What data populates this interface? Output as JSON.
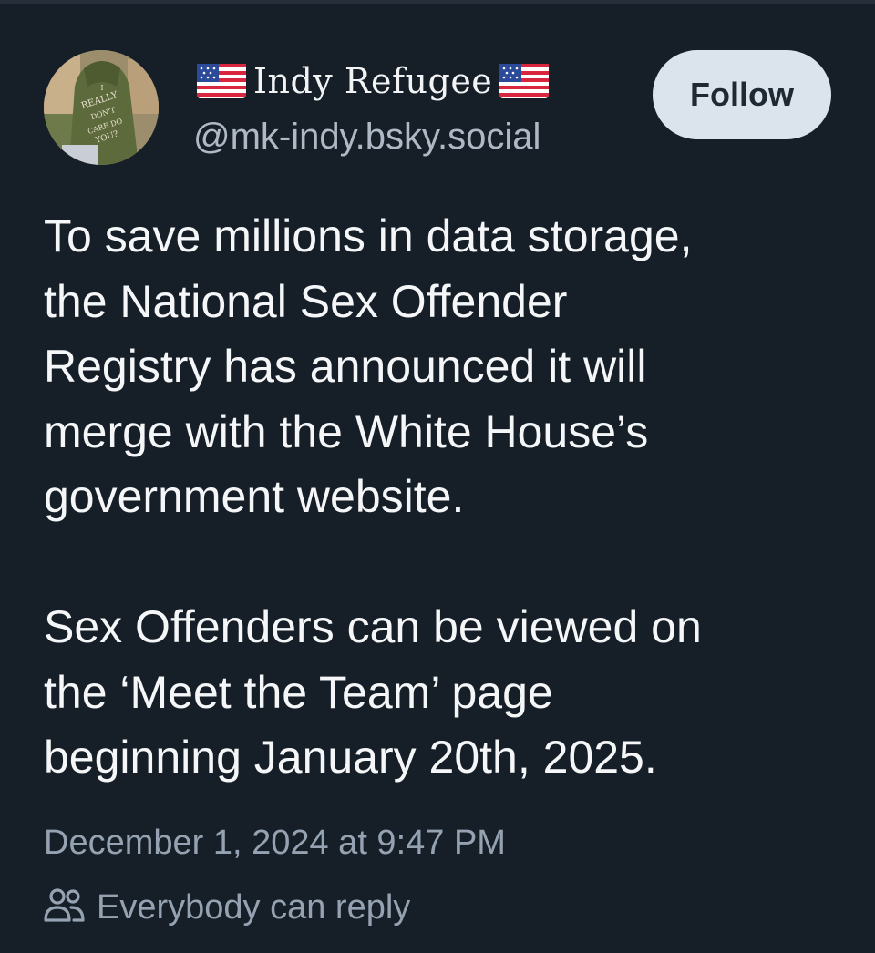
{
  "author": {
    "display_name": "Indy Refugee",
    "handle": "@mk-indy.bsky.social",
    "flag_icon": "us-flag-icon",
    "avatar_text": "I REALLY DON'T CARE DO U?"
  },
  "follow_label": "Follow",
  "post": {
    "paragraph_1": "To save millions in data storage,\nthe National Sex Offender\nRegistry has announced it will\nmerge with the White House’s\ngovernment website.",
    "paragraph_2": "Sex Offenders can be viewed on\nthe ‘Meet the Team’ page\nbeginning January 20th, 2025."
  },
  "timestamp": "December 1, 2024 at 9:47 PM",
  "reply_setting": {
    "icon": "people-icon",
    "label": "Everybody can reply"
  },
  "colors": {
    "background": "#161e27",
    "text": "#f4f6f8",
    "muted": "#95a2b1",
    "follow_bg": "#dbe3ec"
  }
}
